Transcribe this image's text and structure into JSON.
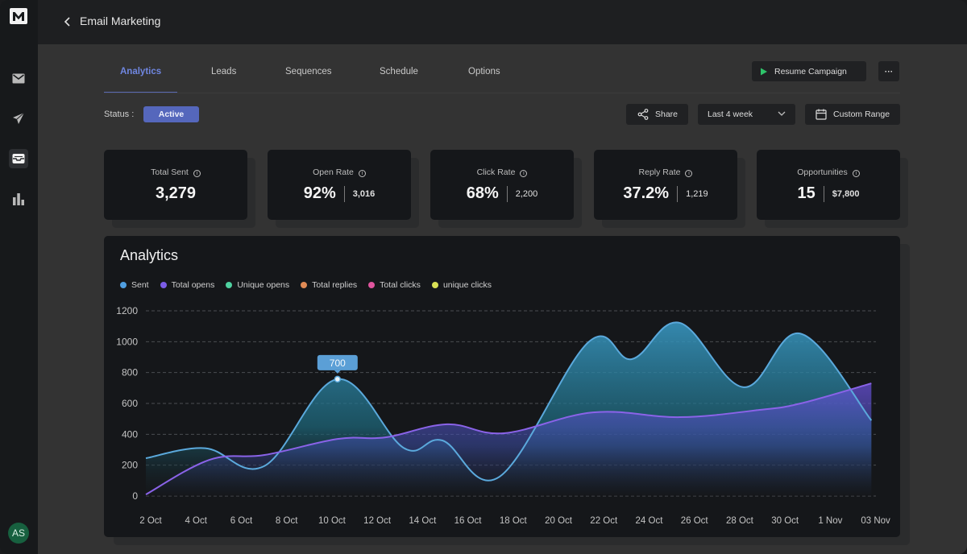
{
  "app": {
    "logo": "M",
    "sidebar": [
      {
        "name": "mail-icon",
        "label": "Mail"
      },
      {
        "name": "send-icon",
        "label": "Send"
      },
      {
        "name": "inbox-icon",
        "label": "Inbox"
      },
      {
        "name": "bar-chart-icon",
        "label": "Analytics"
      }
    ],
    "avatar": "AS"
  },
  "header": {
    "title": "Email Marketing"
  },
  "tabs": [
    {
      "label": "Analytics",
      "active": true
    },
    {
      "label": "Leads",
      "active": false
    },
    {
      "label": "Sequences",
      "active": false
    },
    {
      "label": "Schedule",
      "active": false
    },
    {
      "label": "Options",
      "active": false
    }
  ],
  "actions": {
    "resume_label": "Resume Campaign",
    "more_label": "···",
    "share_label": "Share",
    "range_select": "Last 4 week",
    "custom_range_label": "Custom Range"
  },
  "status": {
    "label": "Status :",
    "value": "Active"
  },
  "stats": [
    {
      "label": "Total Sent",
      "value": "3,279",
      "secondary": null
    },
    {
      "label": "Open Rate",
      "value": "92%",
      "secondary": "3,016"
    },
    {
      "label": "Click Rate",
      "value": "68%",
      "secondary": "2,200"
    },
    {
      "label": "Reply Rate",
      "value": "37.2%",
      "secondary": "1,219"
    },
    {
      "label": "Opportunities",
      "value": "15",
      "secondary": "$7,800"
    }
  ],
  "chart_data": {
    "type": "area",
    "title": "Analytics",
    "legend": [
      {
        "name": "Sent",
        "color": "#4f9ee0"
      },
      {
        "name": "Total opens",
        "color": "#7b5ce6"
      },
      {
        "name": "Unique opens",
        "color": "#4fd1a0"
      },
      {
        "name": "Total replies",
        "color": "#e08a55"
      },
      {
        "name": "Total clicks",
        "color": "#e0559e"
      },
      {
        "name": "unique clicks",
        "color": "#d8e055"
      }
    ],
    "legend_position": "top-left",
    "x_tick_labels": [
      "2 Oct",
      "4 Oct",
      "6 Oct",
      "8 Oct",
      "10 Oct",
      "12 Oct",
      "14 Oct",
      "16 Oct",
      "18 Oct",
      "20 Oct",
      "22 Oct",
      "24 Oct",
      "26 Oct",
      "28 Oct",
      "30 Oct",
      "1 Nov",
      "03 Nov"
    ],
    "y_ticks": [
      0,
      200,
      400,
      600,
      800,
      1000,
      1200
    ],
    "ylim": [
      0,
      1200
    ],
    "xlim": [
      0,
      32
    ],
    "grid": true,
    "series": [
      {
        "name": "Sent",
        "color": "#5ba9dc",
        "points": [
          [
            0,
            245
          ],
          [
            2.6,
            310
          ],
          [
            5.2,
            195
          ],
          [
            8.4,
            757
          ],
          [
            11.3,
            312
          ],
          [
            13.0,
            360
          ],
          [
            15.5,
            125
          ],
          [
            19.4,
            997
          ],
          [
            21.3,
            887
          ],
          [
            23.4,
            1122
          ],
          [
            26.2,
            705
          ],
          [
            28.7,
            1052
          ],
          [
            31.8,
            490
          ]
        ]
      },
      {
        "name": "Total opens",
        "color": "#8a63e8",
        "points": [
          [
            0,
            10
          ],
          [
            2.8,
            235
          ],
          [
            5.2,
            266
          ],
          [
            8.4,
            370
          ],
          [
            10.5,
            380
          ],
          [
            13.2,
            465
          ],
          [
            15.7,
            407
          ],
          [
            19.6,
            542
          ],
          [
            23.4,
            511
          ],
          [
            26.9,
            558
          ],
          [
            28.7,
            600
          ],
          [
            31.8,
            730
          ]
        ]
      }
    ],
    "tooltip": {
      "series": "Sent",
      "x": 8.4,
      "label": "700"
    }
  }
}
